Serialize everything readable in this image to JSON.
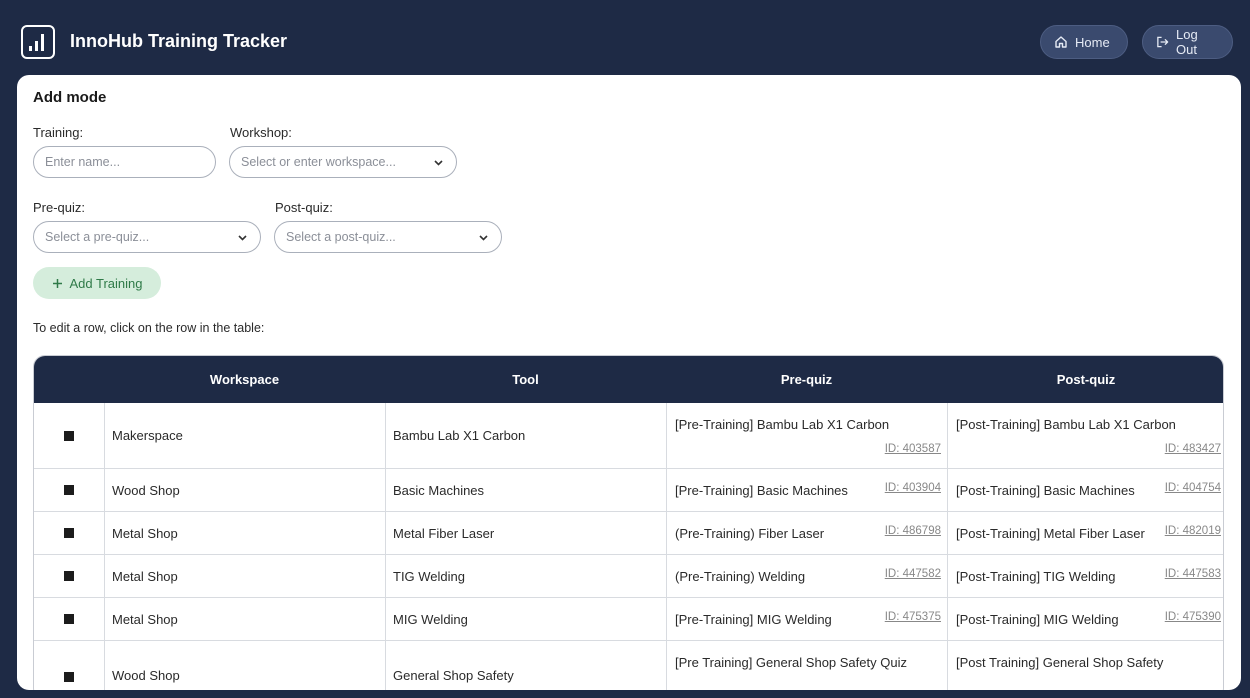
{
  "header": {
    "title": "InnoHub Training Tracker",
    "home_label": "Home",
    "logout_label": "Log Out"
  },
  "form": {
    "mode_title": "Add mode",
    "training_label": "Training:",
    "training_placeholder": "Enter name...",
    "workshop_label": "Workshop:",
    "workshop_placeholder": "Select or enter workspace...",
    "prequiz_label": "Pre-quiz:",
    "prequiz_placeholder": "Select a pre-quiz...",
    "postquiz_label": "Post-quiz:",
    "postquiz_placeholder": "Select a post-quiz...",
    "add_button_label": "Add Training",
    "hint": "To edit a row, click on the row in the table:"
  },
  "table": {
    "columns": [
      "Workspace",
      "Tool",
      "Pre-quiz",
      "Post-quiz"
    ],
    "rows": [
      {
        "workspace": "Makerspace",
        "tool": "Bambu Lab X1 Carbon",
        "prequiz": "[Pre-Training] Bambu Lab X1 Carbon",
        "prequiz_id": "ID: 403587",
        "postquiz": "[Post-Training] Bambu Lab X1 Carbon",
        "postquiz_id": "ID: 483427"
      },
      {
        "workspace": "Wood Shop",
        "tool": "Basic Machines",
        "prequiz": "[Pre-Training] Basic Machines",
        "prequiz_id": "ID: 403904",
        "postquiz": "[Post-Training] Basic Machines",
        "postquiz_id": "ID: 404754"
      },
      {
        "workspace": "Metal Shop",
        "tool": "Metal Fiber Laser",
        "prequiz": "(Pre-Training) Fiber Laser",
        "prequiz_id": "ID: 486798",
        "postquiz": "[Post-Training] Metal Fiber Laser",
        "postquiz_id": "ID: 482019"
      },
      {
        "workspace": "Metal Shop",
        "tool": "TIG Welding",
        "prequiz": "(Pre-Training) Welding",
        "prequiz_id": "ID: 447582",
        "postquiz": "[Post-Training] TIG Welding",
        "postquiz_id": "ID: 447583"
      },
      {
        "workspace": "Metal Shop",
        "tool": "MIG Welding",
        "prequiz": "[Pre-Training] MIG Welding",
        "prequiz_id": "ID: 475375",
        "postquiz": "[Post-Training] MIG Welding",
        "postquiz_id": "ID: 475390"
      },
      {
        "workspace": "Wood Shop",
        "tool": "General Shop Safety",
        "prequiz": "[Pre Training] General Shop Safety Quiz",
        "prequiz_id": "",
        "postquiz": "[Post Training] General Shop Safety",
        "postquiz_id": ""
      }
    ]
  },
  "colors": {
    "navy": "#1e2a45",
    "add_button_bg": "#d5eddc",
    "add_button_text": "#2f7a48"
  }
}
